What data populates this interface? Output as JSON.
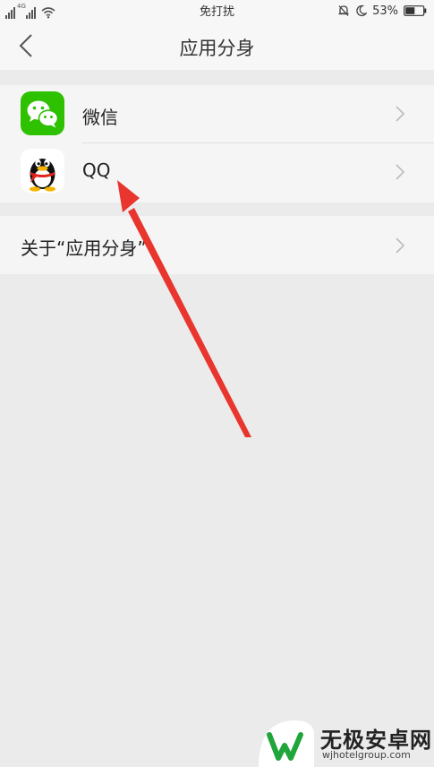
{
  "status_bar": {
    "network_label": "4G",
    "center_text": "免打扰",
    "battery_percent": "53%",
    "battery_level": 0.53
  },
  "nav": {
    "title": "应用分身"
  },
  "apps": [
    {
      "label": "微信",
      "icon": "wechat-icon"
    },
    {
      "label": "QQ",
      "icon": "qq-penguin-icon"
    }
  ],
  "about": {
    "label": "关于“应用分身”"
  },
  "annotation": {
    "color": "#e8352e"
  },
  "watermark": {
    "title": "无极安卓网",
    "url": "wjhotelgroup.com"
  },
  "colors": {
    "wechat_green": "#2dc100",
    "page_background": "#ebebeb",
    "row_background": "#f5f5f5"
  }
}
